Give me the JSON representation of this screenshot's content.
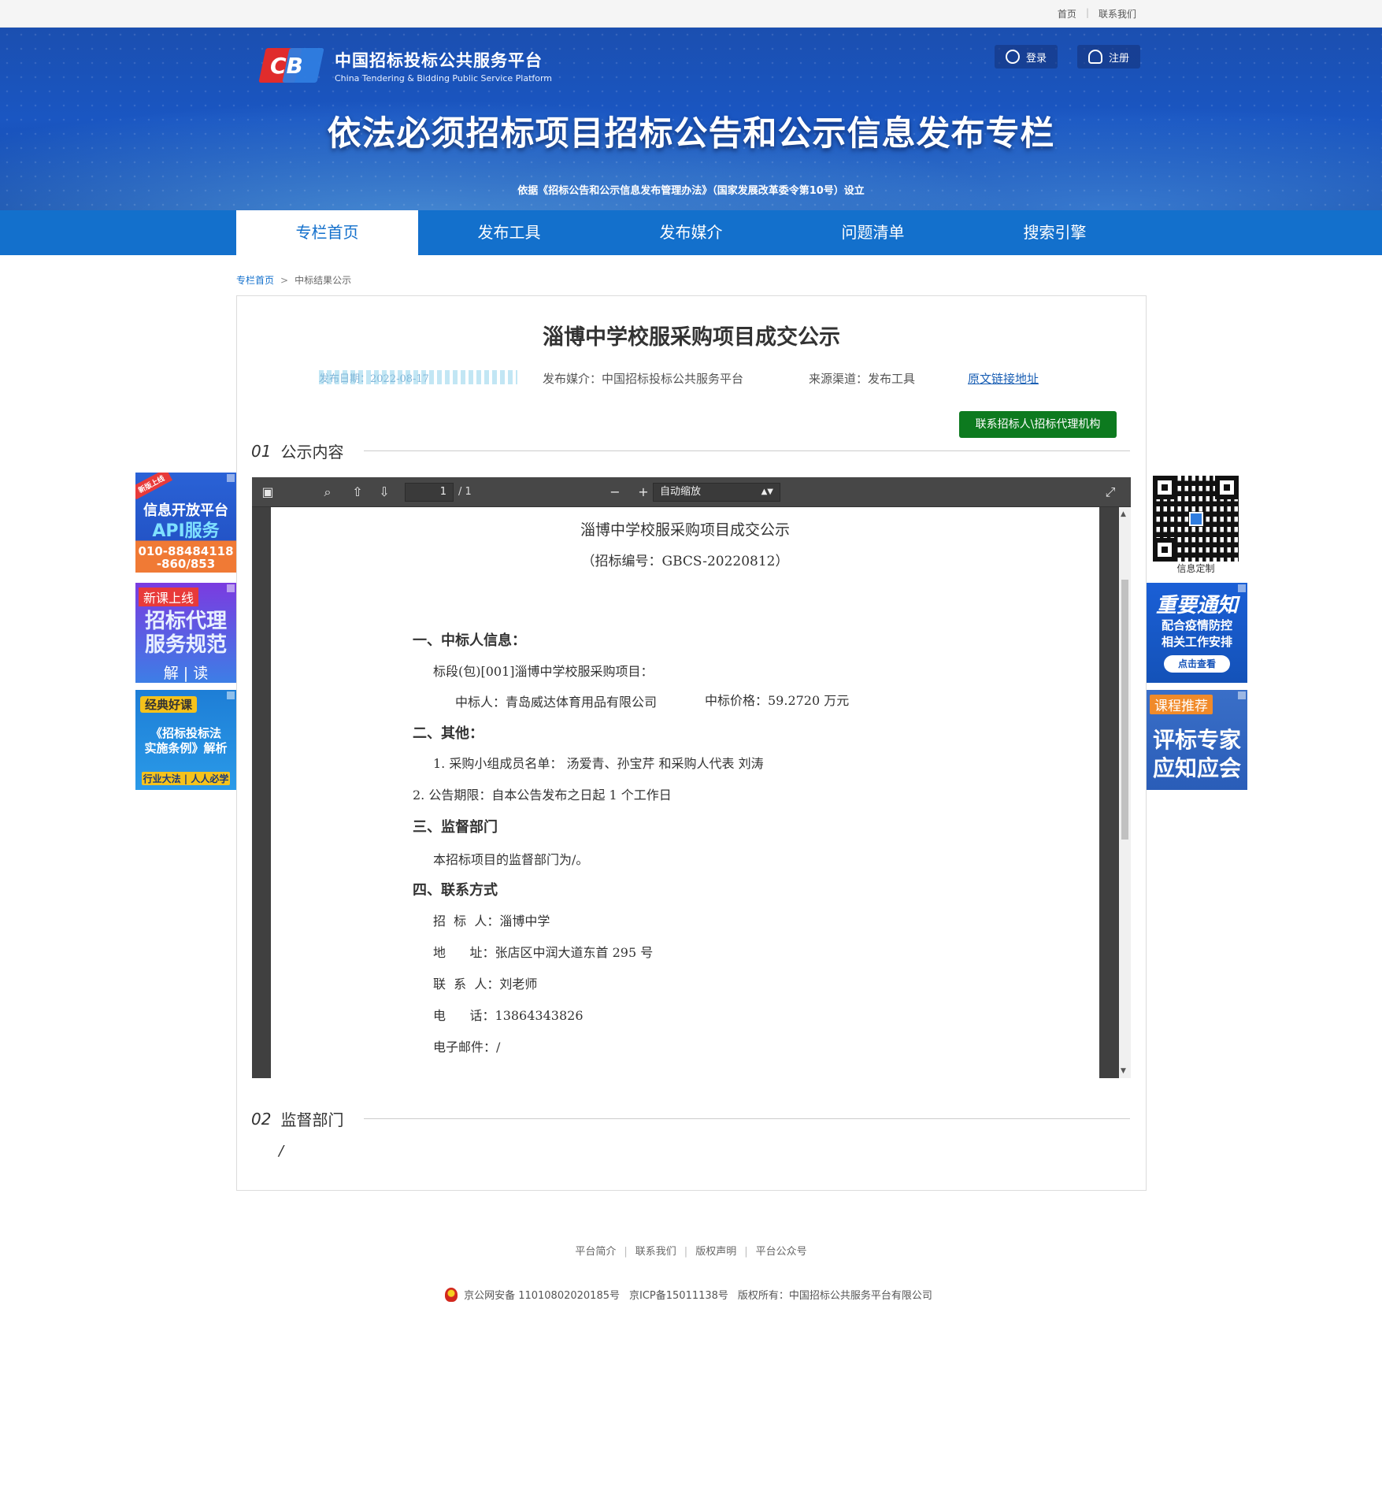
{
  "topbar": {
    "links": [
      "首页",
      "联系我们"
    ]
  },
  "header": {
    "logo_cn": "中国招标投标公共服务平台",
    "logo_en": "China Tendering & Bidding Public Service Platform",
    "logo_mark": "CB",
    "login": "登录",
    "register": "注册",
    "title": "依法必须招标项目招标公告和公示信息发布专栏",
    "basis": "依据《招标公告和公示信息发布管理办法》（国家发展改革委令第10号）设立"
  },
  "nav": [
    "专栏首页",
    "发布工具",
    "发布媒介",
    "问题清单",
    "搜索引擎"
  ],
  "breadcrumb": {
    "home": "专栏首页",
    "arrow": ">",
    "current": "中标结果公示"
  },
  "article": {
    "title": "淄博中学校服采购项目成交公示",
    "date": "发布日期：2022-08-17",
    "media": "发布媒介：中国招标投标公共服务平台",
    "channel": "来源渠道：发布工具",
    "original_link": "原文链接地址",
    "contact_button": "联系招标人\\招标代理机构",
    "section1_num": "01",
    "section1_name": "公示内容",
    "section2_num": "02",
    "section2_name": "监督部门",
    "section2_value": "/"
  },
  "viewer": {
    "page_current": "1",
    "page_total": "/ 1",
    "zoom": "自动缩放",
    "doc": {
      "title": "淄博中学校服采购项目成交公示",
      "code": "（招标编号：GBCS-20220812）",
      "h1": "一、中标人信息：",
      "p1": "标段(包)[001]淄博中学校服采购项目：",
      "p2a": "中标人：青岛威达体育用品有限公司",
      "p2b": "中标价格：59.2720 万元",
      "h2": "二、其他：",
      "p3": "1. 采购小组成员名单：  汤爱青、孙宝芹  和采购人代表  刘涛",
      "p4": "2. 公告期限：自本公告发布之日起 1 个工作日",
      "h3": "三、监督部门",
      "p5": "本招标项目的监督部门为/。",
      "h4": "四、联系方式",
      "p6": "招  标  人：淄博中学",
      "p7": "地      址：张店区中润大道东首 295 号",
      "p8": "联  系  人：刘老师",
      "p9": "电      话：13864343826",
      "p10": "电子邮件：/"
    }
  },
  "ads_left": {
    "ad1": {
      "tag": "新版上线",
      "line1": "信息开放平台",
      "line2": "API服务",
      "line3": "010-88484118\n-860/853"
    },
    "ad2": {
      "tag": "新课上线",
      "line1": "招标代理\n服务规范",
      "line2": "解 | 读"
    },
    "ad3": {
      "tag": "经典好课",
      "line1": "《招标投标法\n实施条例》解析",
      "line2": "行业大法 | 人人必学"
    }
  },
  "ads_right": {
    "qr_caption": "信息定制",
    "ad4": {
      "line1": "重要通知",
      "line2": "配合疫情防控\n相关工作安排",
      "btn": "点击查看"
    },
    "ad5": {
      "tag": "课程推荐",
      "line1": "评标专家\n应知应会"
    }
  },
  "footer": {
    "links": [
      "平台简介",
      "联系我们",
      "版权声明",
      "平台公众号"
    ],
    "police": "京公网安备 11010802020185号",
    "icp": "京ICP备15011138号",
    "copyright": "版权所有：中国招标公共服务平台有限公司"
  }
}
